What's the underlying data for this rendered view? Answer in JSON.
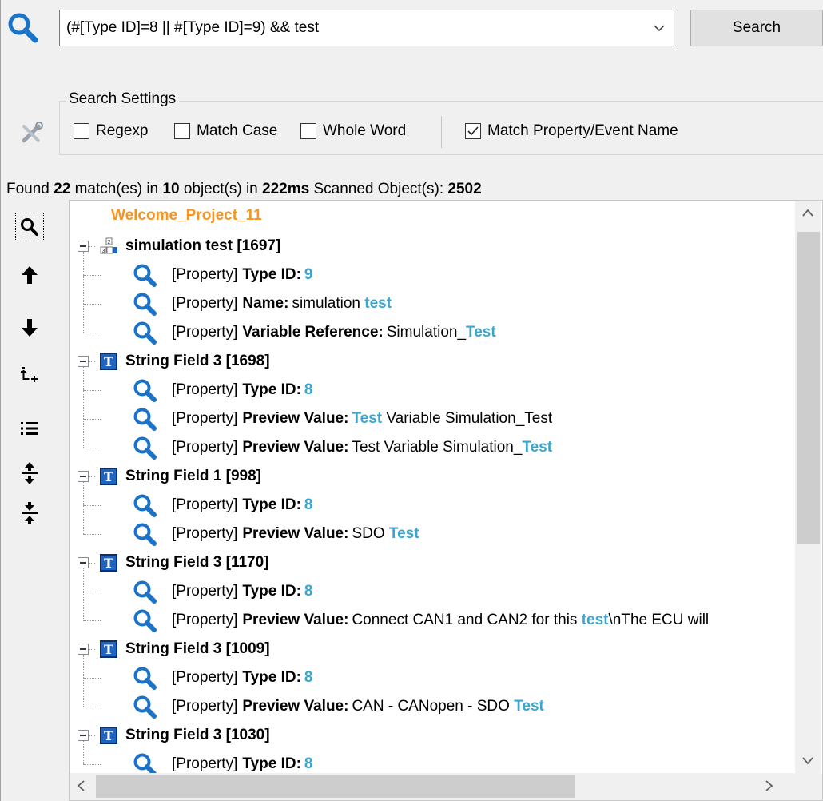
{
  "search": {
    "query": "(#[Type ID]=8 || #[Type ID]=9) && test",
    "button_label": "Search"
  },
  "settings": {
    "legend": "Search Settings",
    "options": [
      {
        "label": "Regexp",
        "checked": false
      },
      {
        "label": "Match Case",
        "checked": false
      },
      {
        "label": "Whole Word",
        "checked": false
      },
      {
        "label": "Match Property/Event Name",
        "checked": true
      }
    ]
  },
  "summary": {
    "found_prefix": "Found",
    "match_count": "22",
    "matches_text": "match(es) in",
    "object_count": "10",
    "objects_text": "object(s) in",
    "time": "222ms",
    "scanned_text": "Scanned Object(s):",
    "scanned_count": "2502"
  },
  "toolbar": {
    "icons": [
      "find-icon",
      "arrow-up-icon",
      "arrow-down-icon",
      "expand-selection-icon",
      "list-icon",
      "expand-all-icon",
      "collapse-all-icon"
    ]
  },
  "tree": {
    "root": "Welcome_Project_11",
    "objects": [
      {
        "label": "simulation test [1697]",
        "icon": "variable-icon",
        "props": [
          {
            "tag": "[Property]",
            "name": "Type ID:",
            "pre": "",
            "hit": "9",
            "post": ""
          },
          {
            "tag": "[Property]",
            "name": "Name:",
            "pre": "simulation ",
            "hit": "test",
            "post": ""
          },
          {
            "tag": "[Property]",
            "name": "Variable Reference:",
            "pre": "Simulation_",
            "hit": "Test",
            "post": ""
          }
        ]
      },
      {
        "label": "String Field 3 [1698]",
        "icon": "text-field-icon",
        "props": [
          {
            "tag": "[Property]",
            "name": "Type ID:",
            "pre": "",
            "hit": "8",
            "post": ""
          },
          {
            "tag": "[Property]",
            "name": "Preview Value:",
            "pre": "",
            "hit": "Test",
            "post": " Variable Simulation_Test"
          },
          {
            "tag": "[Property]",
            "name": "Preview Value:",
            "pre": "Test Variable Simulation_",
            "hit": "Test",
            "post": ""
          }
        ]
      },
      {
        "label": "String Field 1 [998]",
        "icon": "text-field-icon",
        "props": [
          {
            "tag": "[Property]",
            "name": "Type ID:",
            "pre": "",
            "hit": "8",
            "post": ""
          },
          {
            "tag": "[Property]",
            "name": "Preview Value:",
            "pre": "SDO ",
            "hit": "Test",
            "post": ""
          }
        ]
      },
      {
        "label": "String Field 3 [1170]",
        "icon": "text-field-icon",
        "props": [
          {
            "tag": "[Property]",
            "name": "Type ID:",
            "pre": "",
            "hit": "8",
            "post": ""
          },
          {
            "tag": "[Property]",
            "name": "Preview Value:",
            "pre": "Connect CAN1 and CAN2 for this ",
            "hit": "test",
            "post": "\\nThe ECU will"
          }
        ]
      },
      {
        "label": "String Field 3 [1009]",
        "icon": "text-field-icon",
        "props": [
          {
            "tag": "[Property]",
            "name": "Type ID:",
            "pre": "",
            "hit": "8",
            "post": ""
          },
          {
            "tag": "[Property]",
            "name": "Preview Value:",
            "pre": "CAN - CANopen - SDO ",
            "hit": "Test",
            "post": ""
          }
        ]
      },
      {
        "label": "String Field 3 [1030]",
        "icon": "text-field-icon",
        "props": [
          {
            "tag": "[Property]",
            "name": "Type ID:",
            "pre": "",
            "hit": "8",
            "post": ""
          }
        ]
      }
    ]
  }
}
